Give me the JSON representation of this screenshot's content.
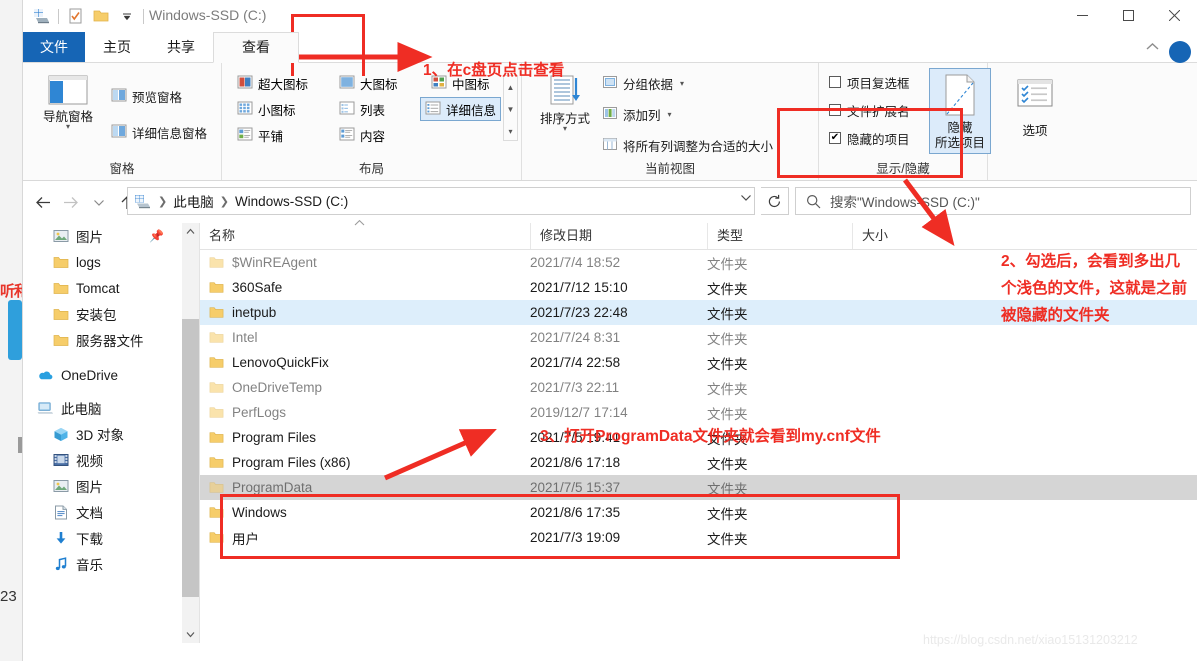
{
  "window": {
    "title": "Windows-SSD (C:)",
    "controls": {
      "minimize": "minimize-icon",
      "maximize": "maximize-icon",
      "close": "close-icon"
    },
    "quick_access": [
      "drive-icon",
      "properties-icon",
      "new-folder-icon",
      "customize-qat-caret"
    ]
  },
  "ribbon": {
    "tabs": [
      {
        "label": "文件",
        "id": "file",
        "active": false
      },
      {
        "label": "主页",
        "id": "home",
        "active": false
      },
      {
        "label": "共享",
        "id": "share",
        "active": false
      },
      {
        "label": "查看",
        "id": "view",
        "active": true
      }
    ],
    "collapse_icon": "chevron-up-icon",
    "help_icon": "help-icon",
    "groups": [
      {
        "label": "窗格"
      },
      {
        "label": "布局"
      },
      {
        "label": "当前视图"
      },
      {
        "label": "显示/隐藏"
      }
    ],
    "panes": {
      "nav_pane": "导航窗格",
      "preview_pane": "预览窗格",
      "details_pane": "详细信息窗格"
    },
    "layout": {
      "extra_large_icons": "超大图标",
      "large_icons": "大图标",
      "medium_icons": "中图标",
      "small_icons": "小图标",
      "list": "列表",
      "details": "详细信息",
      "tiles": "平铺",
      "content": "内容",
      "selected": "详细信息"
    },
    "current_view": {
      "sort_by": "排序方式",
      "group_by": "分组依据",
      "add_columns": "添加列",
      "size_all_columns": "将所有列调整为合适的大小"
    },
    "show_hide": {
      "item_checkboxes": {
        "label": "项目复选框",
        "checked": false
      },
      "file_extensions": {
        "label": "文件扩展名",
        "checked": false
      },
      "hidden_items": {
        "label": "隐藏的项目",
        "checked": true
      },
      "hide_selected": "隐藏\n所选项目",
      "hide_selected_line1": "隐藏",
      "hide_selected_line2": "所选项目",
      "options": "选项"
    }
  },
  "address_bar": {
    "back": "back-arrow-icon",
    "forward": "forward-arrow-icon",
    "recent": "recent-locations-caret",
    "up": "up-arrow-icon",
    "breadcrumb": [
      "此电脑",
      "Windows-SSD (C:)"
    ],
    "dropdown": "chevron-down-icon",
    "refresh": "refresh-icon",
    "search_placeholder": "搜索\"Windows-SSD (C:)\""
  },
  "nav_pane": {
    "items": [
      {
        "label": "图片",
        "icon": "pictures-icon",
        "indent": true,
        "pinned": true
      },
      {
        "label": "logs",
        "icon": "folder-icon",
        "indent": true,
        "pinned": false
      },
      {
        "label": "Tomcat",
        "icon": "folder-icon",
        "indent": true,
        "pinned": false
      },
      {
        "label": "安装包",
        "icon": "folder-icon",
        "indent": true,
        "pinned": false
      },
      {
        "label": "服务器文件",
        "icon": "folder-icon",
        "indent": true,
        "pinned": false
      },
      {
        "label": "OneDrive",
        "icon": "onedrive-icon",
        "indent": false,
        "pinned": false
      },
      {
        "label": "此电脑",
        "icon": "this-pc-icon",
        "indent": false,
        "pinned": false
      },
      {
        "label": "3D 对象",
        "icon": "3d-objects-icon",
        "indent": true,
        "pinned": false
      },
      {
        "label": "视频",
        "icon": "videos-icon",
        "indent": true,
        "pinned": false
      },
      {
        "label": "图片",
        "icon": "pictures-icon",
        "indent": true,
        "pinned": false
      },
      {
        "label": "文档",
        "icon": "documents-icon",
        "indent": true,
        "pinned": false
      },
      {
        "label": "下载",
        "icon": "downloads-icon",
        "indent": true,
        "pinned": false
      },
      {
        "label": "音乐",
        "icon": "music-icon",
        "indent": true,
        "pinned": false
      }
    ]
  },
  "file_list": {
    "columns": [
      "名称",
      "修改日期",
      "类型",
      "大小"
    ],
    "sort_column": "名称",
    "rows": [
      {
        "name": "$WinREAgent",
        "date": "2021/7/4 18:52",
        "type": "文件夹",
        "size": "",
        "hidden": true,
        "state": "normal"
      },
      {
        "name": "360Safe",
        "date": "2021/7/12 15:10",
        "type": "文件夹",
        "size": "",
        "hidden": false,
        "state": "normal"
      },
      {
        "name": "inetpub",
        "date": "2021/7/23 22:48",
        "type": "文件夹",
        "size": "",
        "hidden": false,
        "state": "selected"
      },
      {
        "name": "Intel",
        "date": "2021/7/24 8:31",
        "type": "文件夹",
        "size": "",
        "hidden": true,
        "state": "normal"
      },
      {
        "name": "LenovoQuickFix",
        "date": "2021/7/4 22:58",
        "type": "文件夹",
        "size": "",
        "hidden": false,
        "state": "normal"
      },
      {
        "name": "OneDriveTemp",
        "date": "2021/7/3 22:11",
        "type": "文件夹",
        "size": "",
        "hidden": true,
        "state": "normal"
      },
      {
        "name": "PerfLogs",
        "date": "2019/12/7 17:14",
        "type": "文件夹",
        "size": "",
        "hidden": true,
        "state": "normal"
      },
      {
        "name": "Program Files",
        "date": "2021/7/5 19:41",
        "type": "文件夹",
        "size": "",
        "hidden": false,
        "state": "normal"
      },
      {
        "name": "Program Files (x86)",
        "date": "2021/8/6 17:18",
        "type": "文件夹",
        "size": "",
        "hidden": false,
        "state": "normal"
      },
      {
        "name": "ProgramData",
        "date": "2021/7/5 15:37",
        "type": "文件夹",
        "size": "",
        "hidden": true,
        "state": "hover"
      },
      {
        "name": "Windows",
        "date": "2021/8/6 17:35",
        "type": "文件夹",
        "size": "",
        "hidden": false,
        "state": "normal"
      },
      {
        "name": "用户",
        "date": "2021/7/3 19:09",
        "type": "文件夹",
        "size": "",
        "hidden": false,
        "state": "normal"
      }
    ]
  },
  "annotations": {
    "note1": "1、在c盘页点击查看",
    "note2": "2、勾选后，会看到多出几个浅色的文件，这就是之前被隐藏的文件夹",
    "note3": "3、打开ProgramData文件夹就会看到my.cnf文件",
    "color": "#ef2d24"
  },
  "watermark": "https://blog.csdn.net/xiao15131203212",
  "backdrop": {
    "red_fragment": "听和",
    "number_fragment": "23"
  }
}
